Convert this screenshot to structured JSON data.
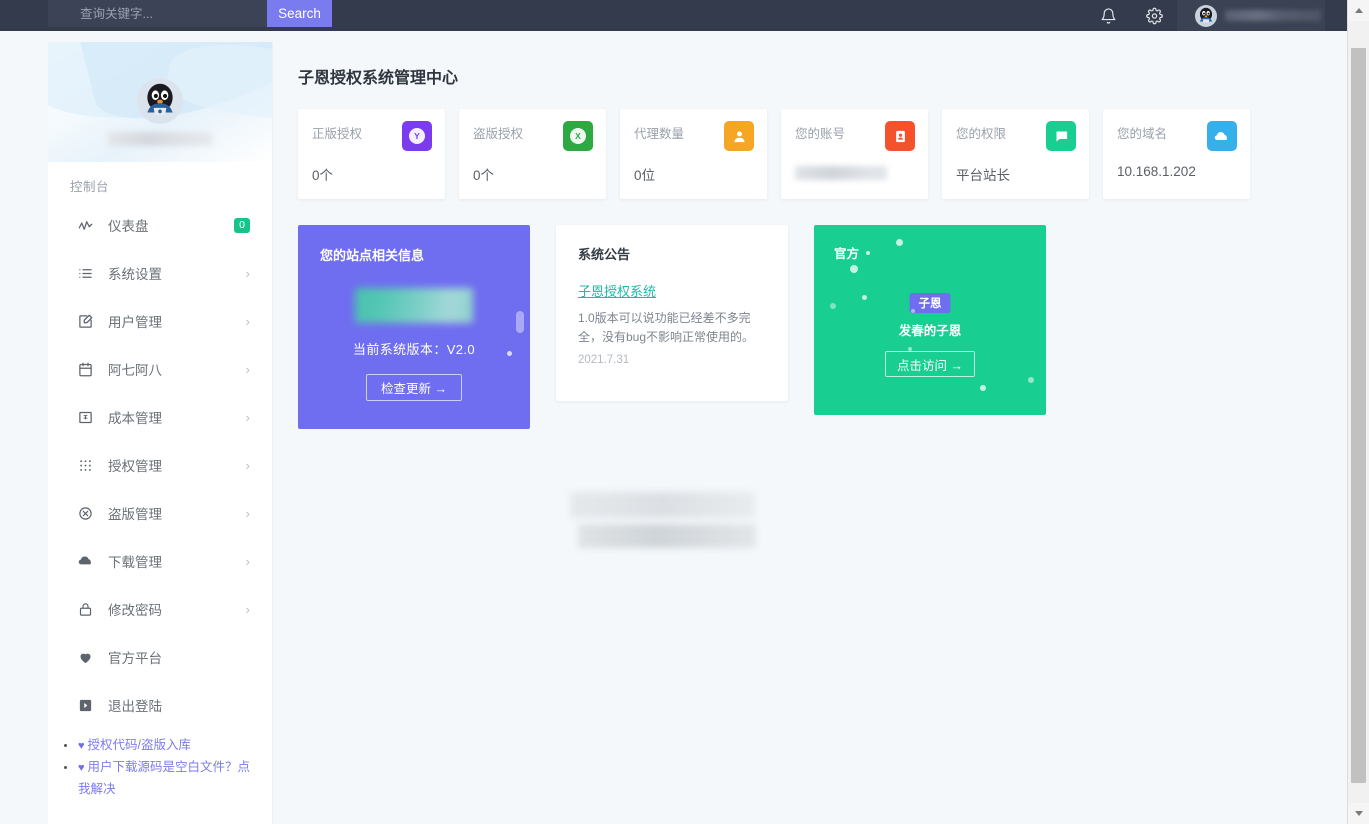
{
  "topbar": {
    "search_placeholder": "查询关键字...",
    "search_value": "",
    "search_button": "Search",
    "bell_icon": "bell-icon",
    "gear_icon": "gear-icon",
    "avatar_icon": "qq-penguin-avatar"
  },
  "sidebar": {
    "section_label": "控制台",
    "items": [
      {
        "label": "仪表盘",
        "icon": "activity-chart-icon",
        "badge": "0",
        "arrow": ""
      },
      {
        "label": "系统设置",
        "icon": "list-settings-icon",
        "badge": "",
        "arrow": "›"
      },
      {
        "label": "用户管理",
        "icon": "user-edit-icon",
        "badge": "",
        "arrow": "›"
      },
      {
        "label": "阿七阿八",
        "icon": "calendar-icon",
        "badge": "",
        "arrow": "›"
      },
      {
        "label": "成本管理",
        "icon": "money-box-icon",
        "badge": "",
        "arrow": "›"
      },
      {
        "label": "授权管理",
        "icon": "grid-dots-icon",
        "badge": "",
        "arrow": "›"
      },
      {
        "label": "盗版管理",
        "icon": "circle-x-icon",
        "badge": "",
        "arrow": "›"
      },
      {
        "label": "下载管理",
        "icon": "cloud-download-icon",
        "badge": "",
        "arrow": "›"
      },
      {
        "label": "修改密码",
        "icon": "lock-icon",
        "badge": "",
        "arrow": "›"
      },
      {
        "label": "官方平台",
        "icon": "heart-icon",
        "badge": "",
        "arrow": ""
      },
      {
        "label": "退出登陆",
        "icon": "logout-icon",
        "badge": "",
        "arrow": ""
      }
    ],
    "links": [
      {
        "label": "授权代码/盗版入库",
        "icon": "heart-icon"
      },
      {
        "label": "用户下载源码是空白文件？点我解决",
        "icon": "heart-icon"
      }
    ]
  },
  "main": {
    "page_title": "子恩授权系统管理中心",
    "stats": [
      {
        "label": "正版授权",
        "value": "0个",
        "icon_letter": "Y",
        "icon_name": "licensed-badge-icon",
        "color": "#7b3cf0",
        "blurred": false
      },
      {
        "label": "盗版授权",
        "value": "0个",
        "icon_letter": "X",
        "icon_name": "pirate-badge-icon",
        "color": "#2ea843",
        "blurred": false
      },
      {
        "label": "代理数量",
        "value": "0位",
        "icon_letter": "",
        "icon_name": "agent-user-icon",
        "color": "#f5a623",
        "blurred": false
      },
      {
        "label": "您的账号",
        "value": "",
        "icon_letter": "",
        "icon_name": "id-card-icon",
        "color": "#f4512c",
        "blurred": true
      },
      {
        "label": "您的权限",
        "value": "平台站长",
        "icon_letter": "",
        "icon_name": "permission-chat-icon",
        "color": "#19ce91",
        "blurred": false
      },
      {
        "label": "您的域名",
        "value": "10.168.1.202",
        "icon_letter": "",
        "icon_name": "cloud-domain-icon",
        "color": "#35b0ea",
        "blurred": false
      }
    ],
    "site_panel": {
      "title": "您的站点相关信息",
      "version": "当前系统版本：V2.0",
      "button": "检查更新  →"
    },
    "notice_panel": {
      "title": "系统公告",
      "link": "子恩授权系统",
      "body": "1.0版本可以说功能已经差不多完全，没有bug不影响正常使用的。",
      "date": "2021.7.31"
    },
    "official_panel": {
      "label": "官方",
      "badge": "子恩",
      "subtitle": "发春的子恩",
      "button": "点击访问  →"
    }
  },
  "scrollbar": {
    "up": "scroll-up-arrow",
    "down": "scroll-down-arrow"
  }
}
